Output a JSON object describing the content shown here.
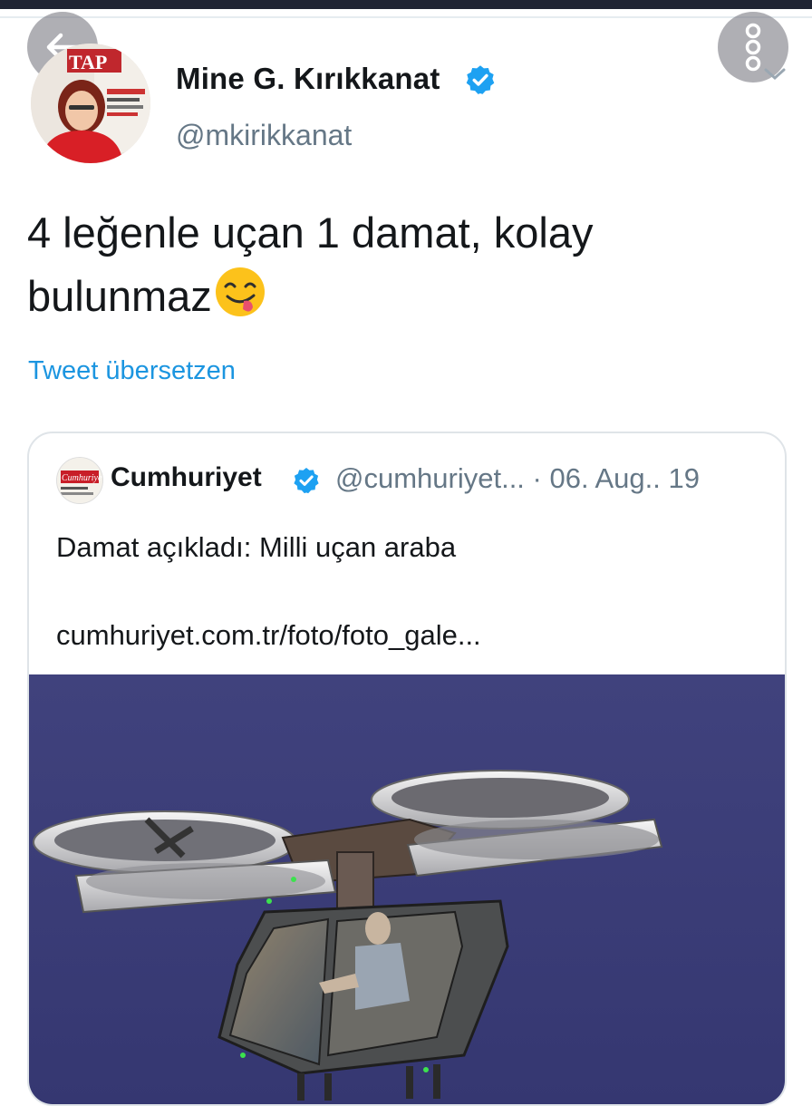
{
  "nav": {
    "back_icon": "arrow-left-icon",
    "more_icon": "more-options-icon",
    "chevron_icon": "chevron-down-icon"
  },
  "tweet": {
    "author_name": "Mine G. Kırıkkanat",
    "author_handle": "@mkirikkanat",
    "text": "4 leğenle uçan 1 damat, kolay bulunmaz",
    "emoji": "face-savoring-food-emoji",
    "translate_label": "Tweet übersetzen",
    "avatar_badge_text": "TAP"
  },
  "quoted_tweet": {
    "author_name": "Cumhuriyet",
    "handle_and_date": "@cumhuriyet... · 06. Aug.. 19",
    "text": "Damat açıkladı: Milli uçan araba",
    "link": "cumhuriyet.com.tr/foto/foto_gale...",
    "avatar_logo_text": "Cumhuriyet",
    "image": "flying-car-render-image"
  },
  "colors": {
    "link_blue": "#1b95e0",
    "verified_blue": "#1da1f2",
    "secondary_text": "#657786",
    "render_background": "#3d3f7a"
  }
}
